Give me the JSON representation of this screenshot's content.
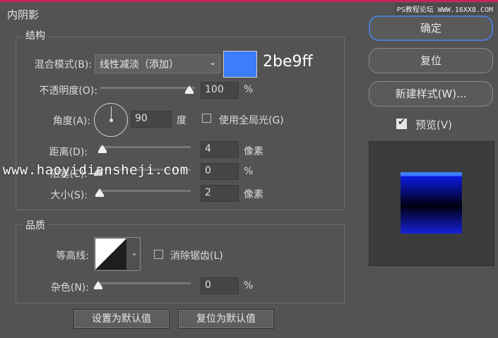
{
  "dialog": {
    "section_title": "内阴影",
    "structure": {
      "title": "结构",
      "blend_mode_label": "混合模式(B):",
      "blend_mode_value": "线性减淡（添加）",
      "color_annotation": "2be9ff",
      "opacity_label": "不透明度(O):",
      "opacity_value": "100",
      "opacity_unit": "%",
      "opacity_fraction": 1.0,
      "angle_label": "角度(A):",
      "angle_value": "90",
      "angle_unit": "度",
      "global_light_label": "使用全局光(G)",
      "global_light_checked": false,
      "distance_label": "距离(D):",
      "distance_value": "4",
      "distance_unit": "像素",
      "choke_label": "阻塞(C):",
      "choke_value": "0",
      "choke_unit": "%",
      "size_label": "大小(S):",
      "size_value": "2",
      "size_unit": "像素"
    },
    "quality": {
      "title": "品质",
      "contour_label": "等高线:",
      "antialias_label": "消除锯齿(L)",
      "antialias_checked": false,
      "noise_label": "杂色(N):",
      "noise_value": "0",
      "noise_unit": "%"
    },
    "bottom_buttons": {
      "make_default": "设置为默认值",
      "reset_default": "复位为默认值"
    },
    "right_panel": {
      "ok": "确定",
      "reset": "复位",
      "new_style": "新建样式(W)...",
      "preview_label": "预览(V)",
      "preview_checked": true
    }
  },
  "overlays": {
    "site_watermark": "PS教程论坛 WWW.16XX8.COM",
    "url_watermark": "www.haoyidiansheji.com"
  },
  "colors": {
    "swatch": "#2be9ff",
    "primary_border": "#4a7bd0"
  }
}
